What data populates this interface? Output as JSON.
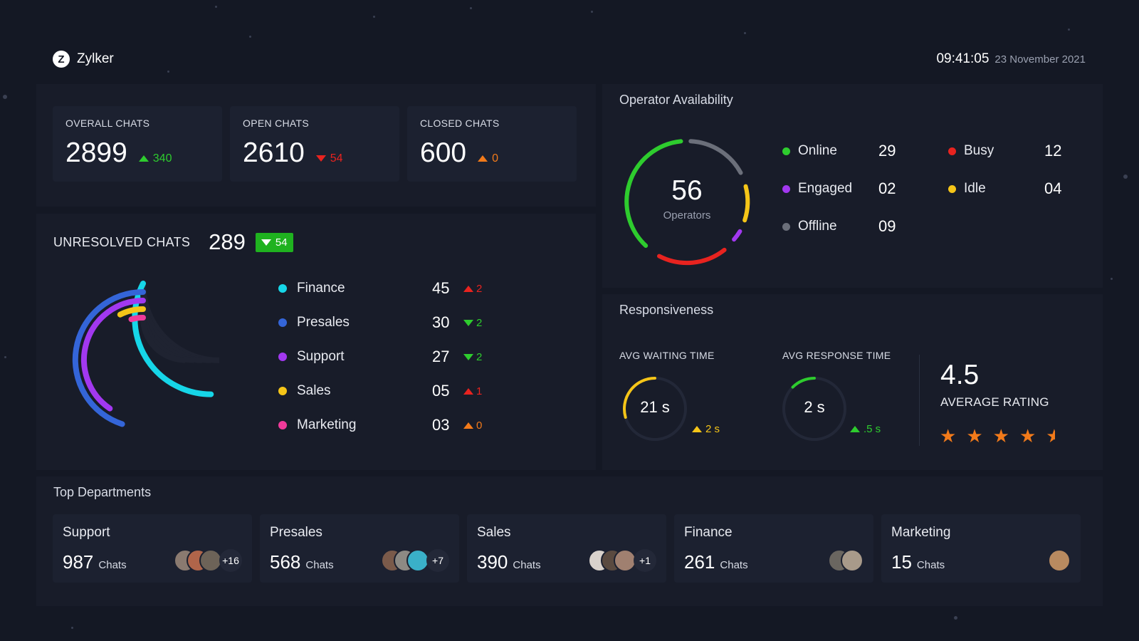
{
  "header": {
    "logo_letter": "Z",
    "brand": "Zylker",
    "time": "09:41:05",
    "date": "23 November 2021"
  },
  "stats": [
    {
      "label": "OVERALL CHATS",
      "value": "2899",
      "delta": "340",
      "direction": "up",
      "color": "#2ecc2e"
    },
    {
      "label": "OPEN CHATS",
      "value": "2610",
      "delta": "54",
      "direction": "down",
      "color": "#e8231f"
    },
    {
      "label": "CLOSED CHATS",
      "value": "600",
      "delta": "0",
      "direction": "up",
      "color": "#f27a1a"
    }
  ],
  "unresolved": {
    "title": "UNRESOLVED CHATS",
    "value": "289",
    "badge": "54",
    "badge_color": "#1fb21f",
    "chart_data": {
      "type": "radial-bar",
      "categories": [
        "Finance",
        "Presales",
        "Support",
        "Sales",
        "Marketing"
      ],
      "values": [
        45,
        30,
        27,
        5,
        3
      ]
    },
    "items": [
      {
        "name": "Finance",
        "value": "45",
        "delta": "2",
        "direction": "up",
        "dot": "#16d6e8",
        "delta_color": "#e8231f"
      },
      {
        "name": "Presales",
        "value": "30",
        "delta": "2",
        "direction": "down",
        "dot": "#3465d8",
        "delta_color": "#2ecc2e"
      },
      {
        "name": "Support",
        "value": "27",
        "delta": "2",
        "direction": "down",
        "dot": "#a238f0",
        "delta_color": "#2ecc2e"
      },
      {
        "name": "Sales",
        "value": "05",
        "delta": "1",
        "direction": "up",
        "dot": "#f5c518",
        "delta_color": "#e8231f"
      },
      {
        "name": "Marketing",
        "value": "03",
        "delta": "0",
        "direction": "up",
        "dot": "#f03a9a",
        "delta_color": "#f27a1a"
      }
    ]
  },
  "operators": {
    "title": "Operator Availability",
    "total": "56",
    "total_label": "Operators",
    "statuses": [
      {
        "name": "Online",
        "value": "29",
        "color": "#2ecc2e"
      },
      {
        "name": "Busy",
        "value": "12",
        "color": "#e8231f"
      },
      {
        "name": "Engaged",
        "value": "02",
        "color": "#a238f0"
      },
      {
        "name": "Idle",
        "value": "04",
        "color": "#f5c518"
      },
      {
        "name": "Offline",
        "value": "09",
        "color": "#6b6f7a"
      }
    ]
  },
  "responsiveness": {
    "title": "Responsiveness",
    "waiting": {
      "label": "AVG WAITING TIME",
      "value": "21 s",
      "delta": "2 s",
      "direction": "up",
      "color": "#f5c518"
    },
    "response": {
      "label": "AVG RESPONSE TIME",
      "value": "2 s",
      "delta": ".5 s",
      "direction": "up",
      "color": "#2ecc2e"
    },
    "rating": {
      "value": "4.5",
      "label": "AVERAGE RATING",
      "stars": 4.5,
      "star_color": "#f27a1a"
    }
  },
  "departments": {
    "title": "Top Departments",
    "unit": "Chats",
    "items": [
      {
        "name": "Support",
        "count": "987",
        "more": "+16",
        "avatars": [
          "#8a7a70",
          "#b0654a",
          "#6d6358"
        ]
      },
      {
        "name": "Presales",
        "count": "568",
        "more": "+7",
        "avatars": [
          "#7a5a4a",
          "#8d8a84",
          "#3ab0c8"
        ]
      },
      {
        "name": "Sales",
        "count": "390",
        "more": "+1",
        "avatars": [
          "#d9d2cc",
          "#5a4a40",
          "#a08070"
        ]
      },
      {
        "name": "Finance",
        "count": "261",
        "more": "",
        "avatars": [
          "#6a6660",
          "#a89a8a"
        ]
      },
      {
        "name": "Marketing",
        "count": "15",
        "more": "",
        "avatars": [
          "#b88a60"
        ]
      }
    ]
  }
}
